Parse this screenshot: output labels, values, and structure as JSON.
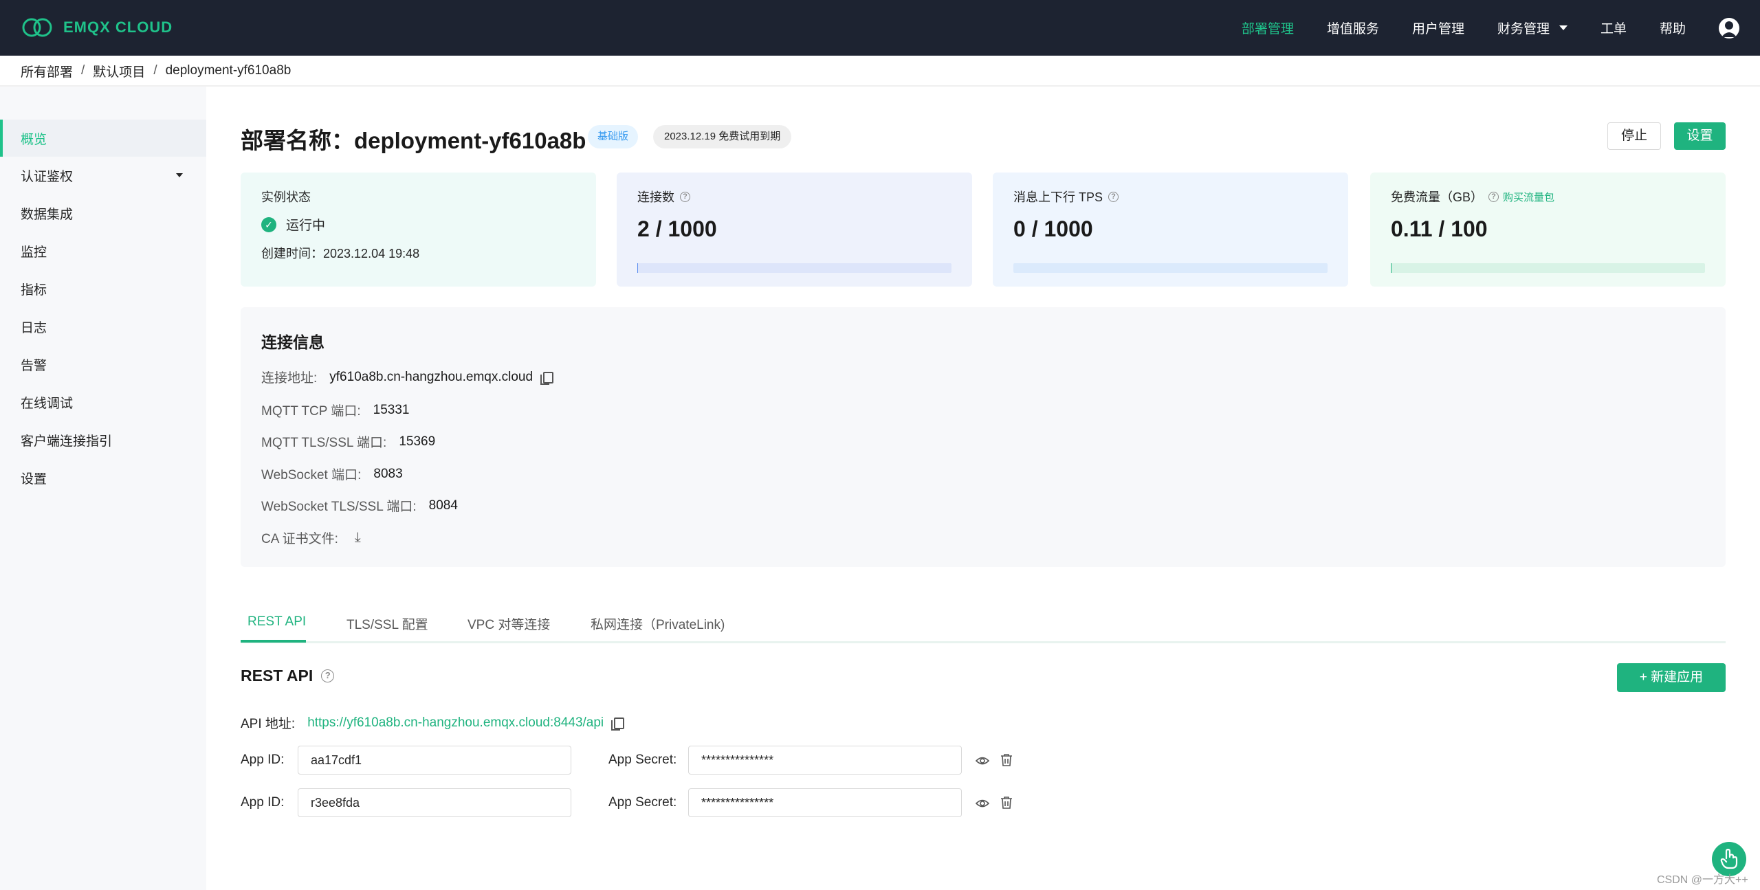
{
  "brand": {
    "name": "EMQX CLOUD",
    "accent": "#1fb37f",
    "header_bg": "#1d2331"
  },
  "topnav": {
    "items": [
      {
        "label": "部署管理",
        "active": true
      },
      {
        "label": "增值服务"
      },
      {
        "label": "用户管理"
      },
      {
        "label": "财务管理",
        "dropdown": true
      },
      {
        "label": "工单"
      },
      {
        "label": "帮助"
      }
    ],
    "avatar_icon": "user-avatar-icon"
  },
  "breadcrumb": [
    "所有部署",
    "默认项目",
    "deployment-yf610a8b"
  ],
  "sidebar": {
    "items": [
      {
        "label": "概览",
        "active": true
      },
      {
        "label": "认证鉴权",
        "expandable": true
      },
      {
        "label": "数据集成"
      },
      {
        "label": "监控"
      },
      {
        "label": "指标"
      },
      {
        "label": "日志"
      },
      {
        "label": "告警"
      },
      {
        "label": "在线调试"
      },
      {
        "label": "客户端连接指引"
      },
      {
        "label": "设置"
      }
    ]
  },
  "header": {
    "title": "部署名称：deployment-yf610a8b",
    "badge_basic": "基础版",
    "badge_trial": "2023.12.19 免费试用到期",
    "stop_label": "停止",
    "settings_label": "设置"
  },
  "cards": {
    "status": {
      "label": "实例状态",
      "state": "运行中",
      "created": "创建时间：2023.12.04 19:48"
    },
    "connections": {
      "label": "连接数",
      "value": "2 / 1000",
      "fraction": 0.002
    },
    "tps": {
      "label": "消息上下行 TPS",
      "value": "0 / 1000",
      "fraction": 0.0
    },
    "traffic": {
      "label": "免费流量（GB）",
      "link": "购买流量包",
      "value": "0.11 / 100",
      "fraction": 0.0011
    }
  },
  "connection_info": {
    "title": "连接信息",
    "rows": [
      {
        "key": "连接地址:",
        "value": "yf610a8b.cn-hangzhou.emqx.cloud",
        "copy": true
      },
      {
        "key": "MQTT TCP 端口:",
        "value": "15331"
      },
      {
        "key": "MQTT TLS/SSL 端口:",
        "value": "15369"
      },
      {
        "key": "WebSocket 端口:",
        "value": "8083"
      },
      {
        "key": "WebSocket TLS/SSL 端口:",
        "value": "8084"
      },
      {
        "key": "CA 证书文件:",
        "value": "",
        "download": true
      }
    ]
  },
  "tabs": [
    {
      "label": "REST API",
      "active": true
    },
    {
      "label": "TLS/SSL 配置"
    },
    {
      "label": "VPC 对等连接"
    },
    {
      "label": "私网连接（PrivateLink)"
    }
  ],
  "rest_api": {
    "title": "REST API",
    "new_app_label": "+ 新建应用",
    "api_address_label": "API 地址:",
    "api_address": "https://yf610a8b.cn-hangzhou.emqx.cloud:8443/api",
    "app_id_label": "App ID:",
    "app_secret_label": "App Secret:",
    "apps": [
      {
        "id": "aa17cdf1",
        "secret": "***************"
      },
      {
        "id": "r3ee8fda",
        "secret": "***************"
      }
    ]
  },
  "watermark": "CSDN @一方大++"
}
